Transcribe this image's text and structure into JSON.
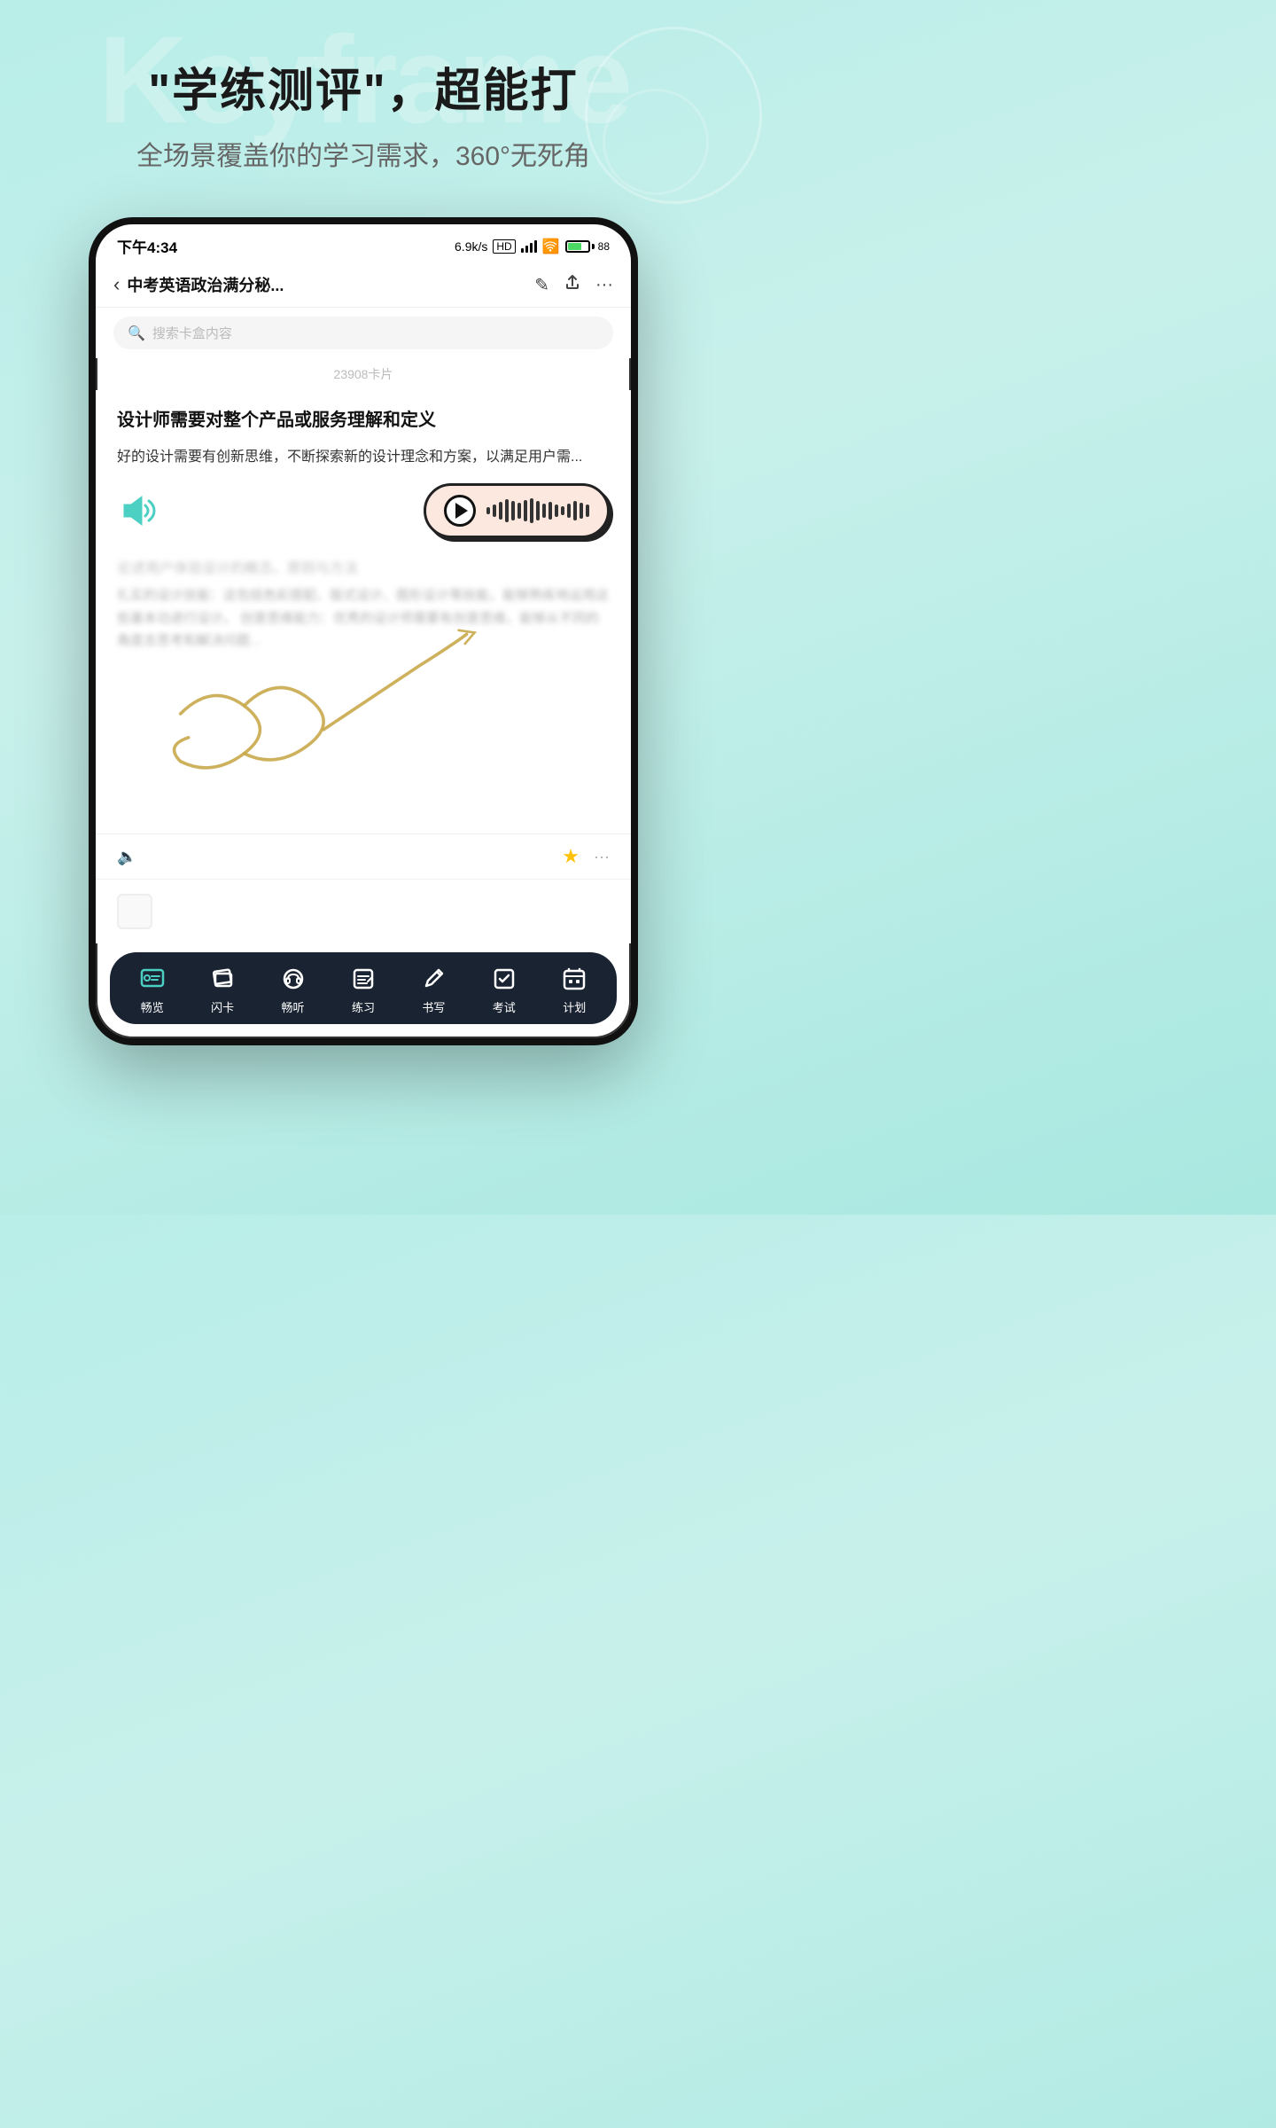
{
  "background_color": "#b8ede8",
  "watermark": "Keyframe",
  "header": {
    "main_title": "\"学练测评\"，超能打",
    "sub_title": "全场景覆盖你的学习需求，360°无死角"
  },
  "status_bar": {
    "time": "下午4:34",
    "speed": "6.9k/s",
    "hd_label": "HD",
    "battery_percent": "88"
  },
  "nav_bar": {
    "title": "中考英语政治满分秘...",
    "back_icon": "‹",
    "edit_icon": "✎",
    "share_icon": "↑",
    "more_icon": "···"
  },
  "search": {
    "placeholder": "搜索卡盒内容"
  },
  "card_count": "23908卡片",
  "card": {
    "title": "设计师需要对整个产品或服务理解和定义",
    "body_text": "好的设计需要有创新思维，不断探索新的设计理念和方案，以满足用户需...",
    "lower_title": "论述用户体验设计的概念、原则与方法",
    "lower_body": "扎实的设计技能：这包括色彩搭配、版式设计、图形设计等技能，能够熟练地运用这些基本功进行设计。\n创意思维能力：优秀的设计师需要有创意思维，能够从不同的角度去思考和解决问题..."
  },
  "audio_player": {
    "waveform_heights": [
      8,
      14,
      20,
      26,
      22,
      18,
      24,
      28,
      22,
      16,
      20,
      14,
      10,
      16,
      22,
      18,
      14
    ]
  },
  "bottom_nav": {
    "items": [
      {
        "label": "畅览",
        "icon": "browse"
      },
      {
        "label": "闪卡",
        "icon": "flashcard"
      },
      {
        "label": "畅听",
        "icon": "listen"
      },
      {
        "label": "练习",
        "icon": "practice"
      },
      {
        "label": "书写",
        "icon": "write"
      },
      {
        "label": "考试",
        "icon": "exam"
      },
      {
        "label": "计划",
        "icon": "plan"
      }
    ]
  }
}
